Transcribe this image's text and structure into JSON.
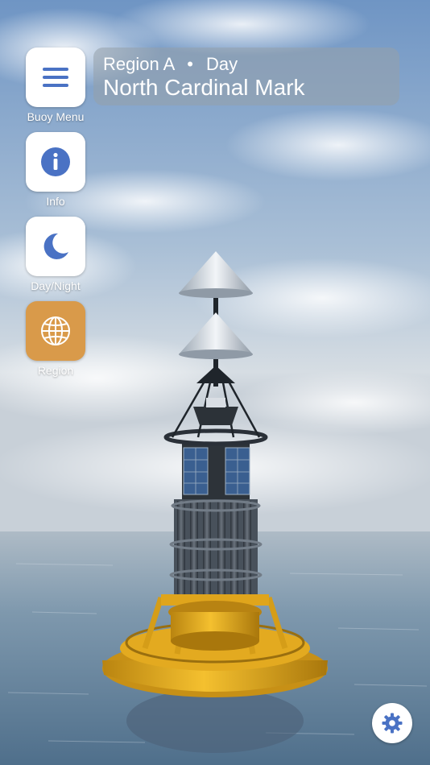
{
  "header": {
    "region": "Region A",
    "separator": "•",
    "mode": "Day",
    "mark_name": "North Cardinal Mark"
  },
  "sidebar": {
    "items": [
      {
        "label": "Buoy Menu",
        "icon": "menu-icon",
        "active": false
      },
      {
        "label": "Info",
        "icon": "info-icon",
        "active": false
      },
      {
        "label": "Day/Night",
        "icon": "moon-icon",
        "active": false
      },
      {
        "label": "Region",
        "icon": "globe-icon",
        "active": true
      }
    ]
  },
  "settings": {
    "icon": "gear-icon"
  },
  "colors": {
    "accent": "#4a72c4",
    "active_tile": "#d99a4a",
    "buoy_yellow": "#e0a51c",
    "sea": "#5f7e98",
    "sky": "#7f9fc0"
  }
}
